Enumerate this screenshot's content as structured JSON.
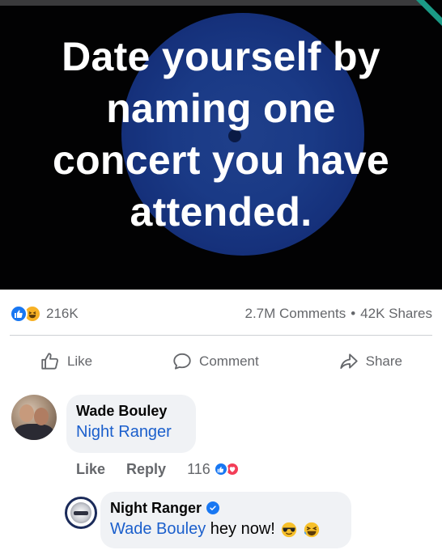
{
  "post": {
    "headline_lines": [
      "Date yourself by",
      "naming one",
      "concert you have",
      "attended."
    ]
  },
  "stats": {
    "reaction_icons": [
      "like-icon",
      "haha-icon"
    ],
    "reaction_count": "216K",
    "comments": "2.7M Comments",
    "separator": "•",
    "shares": "42K Shares"
  },
  "actions": {
    "like": "Like",
    "comment": "Comment",
    "share": "Share"
  },
  "comments": [
    {
      "author": "Wade Bouley",
      "text": "Night Ranger",
      "like_label": "Like",
      "reply_label": "Reply",
      "reaction_count": "116",
      "reaction_icons": [
        "like-icon",
        "love-icon"
      ]
    },
    {
      "author": "Night Ranger",
      "verified": true,
      "mention": "Wade Bouley",
      "text": " hey now!",
      "emojis": [
        "sunglasses-emoji",
        "laughing-emoji"
      ]
    }
  ],
  "colors": {
    "accent": "#1877f2",
    "mention": "#1b5fcc",
    "muted": "#65676b",
    "bubble": "#f0f2f5"
  }
}
